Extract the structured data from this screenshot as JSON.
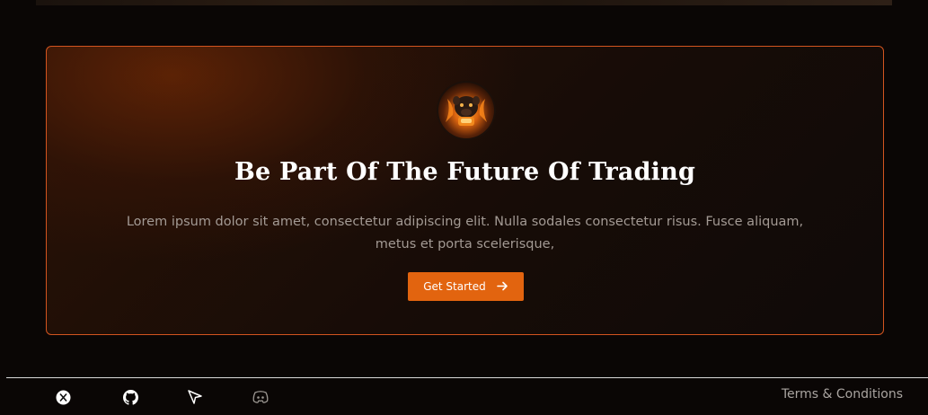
{
  "cta": {
    "title": "Be Part Of The Future Of Trading",
    "description": "Lorem ipsum dolor sit amet, consectetur adipiscing elit. Nulla sodales consectetur risus. Fusce aliquam, metus et porta scelerisque,",
    "button_label": "Get Started",
    "button_icon": "arrow-right-icon",
    "logo_icon": "bulldog-mascot-logo"
  },
  "footer": {
    "socials": [
      {
        "icon": "x-twitter-icon"
      },
      {
        "icon": "github-icon"
      },
      {
        "icon": "cursor-icon"
      },
      {
        "icon": "discord-icon"
      }
    ],
    "terms_label": "Terms & Conditions"
  },
  "colors": {
    "accent": "#e2640f",
    "border": "#d2541f",
    "background": "#0a0605"
  }
}
